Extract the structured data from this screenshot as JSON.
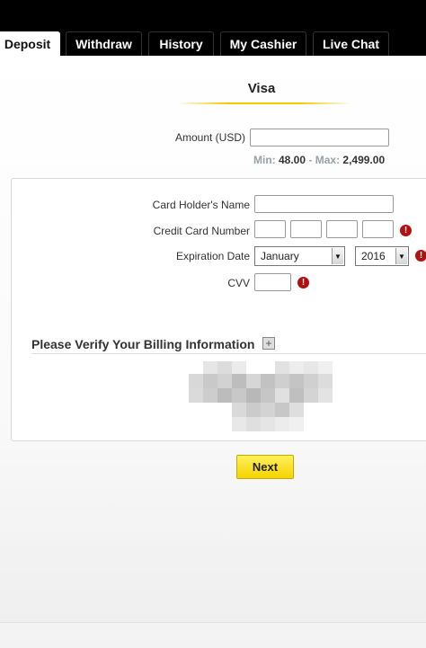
{
  "tabs": [
    {
      "label": "Deposit",
      "active": true
    },
    {
      "label": "Withdraw",
      "active": false
    },
    {
      "label": "History",
      "active": false
    },
    {
      "label": "My Cashier",
      "active": false
    },
    {
      "label": "Live Chat",
      "active": false
    }
  ],
  "method": {
    "title": "Visa"
  },
  "amount": {
    "label": "Amount (USD)",
    "value": "",
    "min_label": "Min:",
    "min": "48.00",
    "separator": "-",
    "max_label": "Max:",
    "max": "2,499.00"
  },
  "card": {
    "holder_label": "Card Holder's Name",
    "holder_value": "",
    "number_label": "Credit Card Number",
    "number_parts": [
      "",
      "",
      "",
      ""
    ],
    "expiry_label": "Expiration Date",
    "expiry_month": "January",
    "expiry_year": "2016",
    "cvv_label": "CVV",
    "cvv_value": "",
    "error_glyph": "!"
  },
  "billing": {
    "title": "Please Verify Your Billing Information",
    "expand_glyph": "+"
  },
  "actions": {
    "next_label": "Next"
  },
  "colors": {
    "accent": "#f5d200",
    "error": "#b3110f",
    "tab_bg": "#000000"
  }
}
